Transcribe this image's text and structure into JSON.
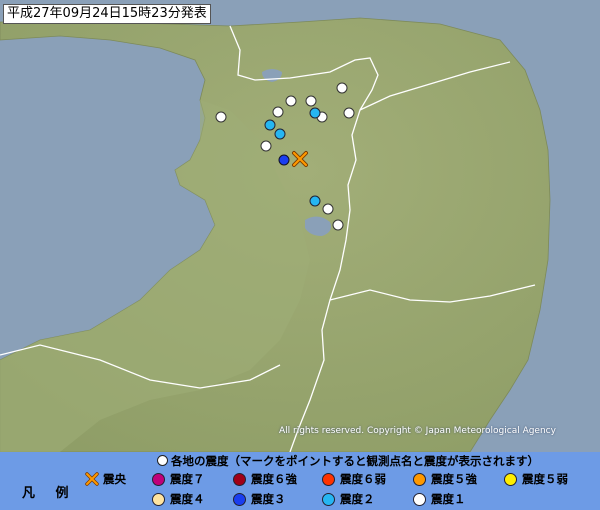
{
  "title": "平成27年09月24日15時23分発表",
  "copyright": "All rights reserved. Copyright © Japan Meteorological Agency",
  "legend": {
    "heading": "各地の震度（マークをポイントすると観測点名と震度が表示されます）",
    "label": "凡 例",
    "epicenter_label": "震央",
    "items": [
      {
        "label": "震度７",
        "color": "#c0007a"
      },
      {
        "label": "震度６強",
        "color": "#a00018"
      },
      {
        "label": "震度６弱",
        "color": "#ff3300"
      },
      {
        "label": "震度５強",
        "color": "#ff9900"
      },
      {
        "label": "震度５弱",
        "color": "#ffee00"
      },
      {
        "label": "震度４",
        "color": "#ffe4a0"
      },
      {
        "label": "震度３",
        "color": "#1a3ef0"
      },
      {
        "label": "震度２",
        "color": "#26b6f2"
      },
      {
        "label": "震度１",
        "color": "#ffffff"
      }
    ]
  },
  "colors": {
    "sea": "#8aa0b8",
    "land": "#a4b27a",
    "legend_bg": "#6d9be6",
    "epicenter": "#ff8800"
  }
}
